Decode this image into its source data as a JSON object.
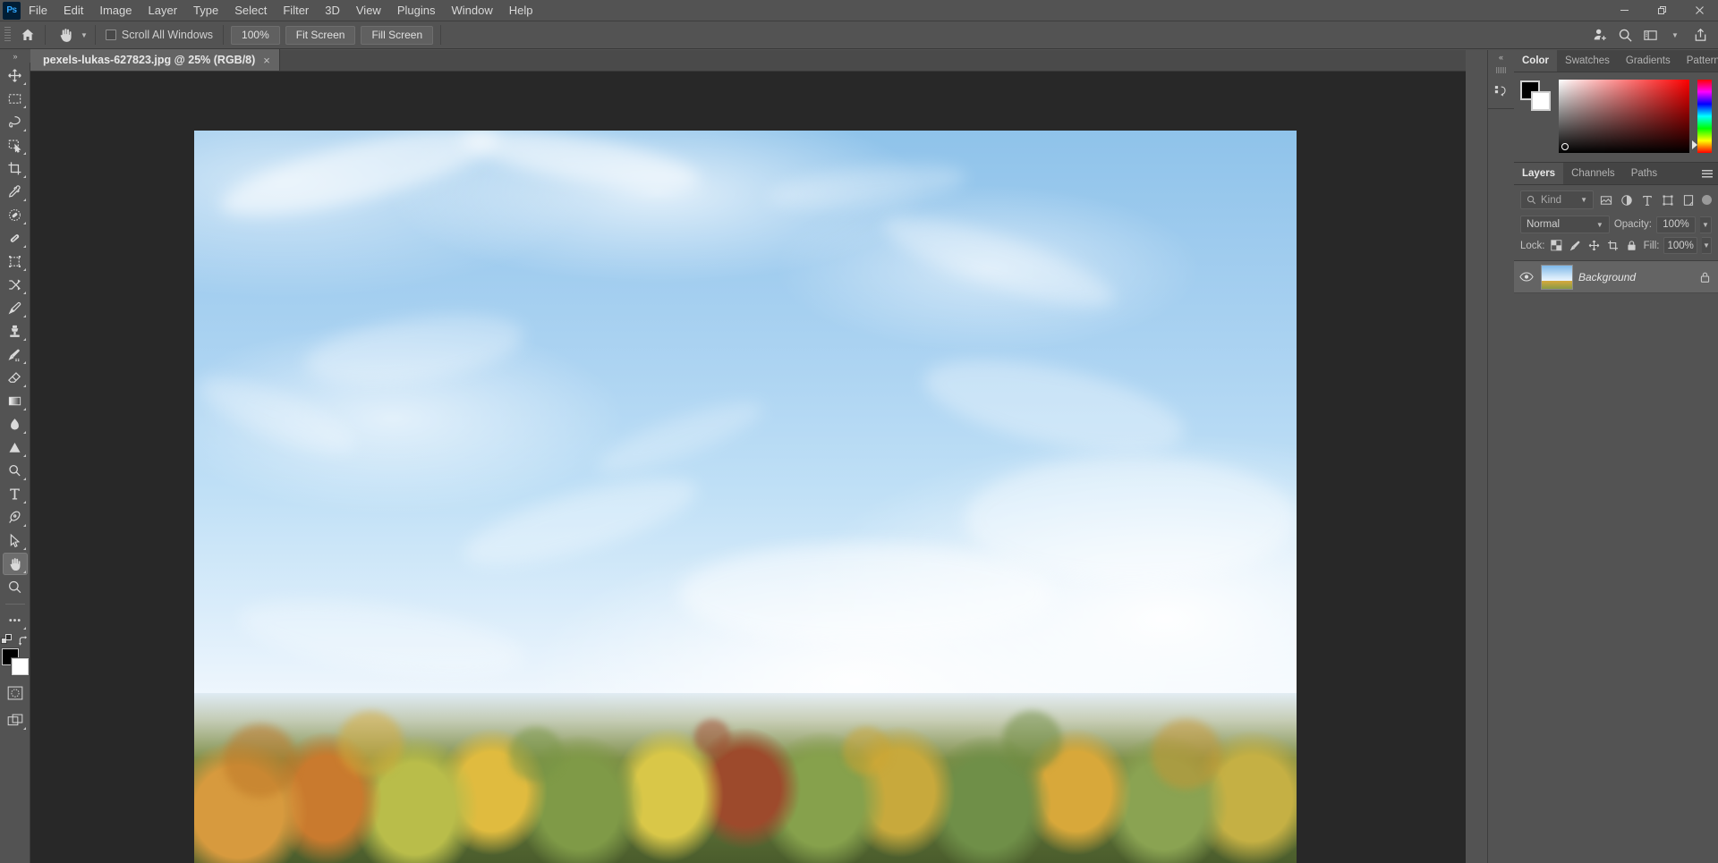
{
  "app": {
    "name": "Adobe Photoshop",
    "logo_text": "Ps"
  },
  "menubar": {
    "items": [
      "File",
      "Edit",
      "Image",
      "Layer",
      "Type",
      "Select",
      "Filter",
      "3D",
      "View",
      "Plugins",
      "Window",
      "Help"
    ],
    "window_controls": [
      "minimize",
      "restore",
      "close"
    ]
  },
  "options_bar": {
    "home_icon": "home-icon",
    "active_tool": "hand-tool",
    "tool_preset_chevron": "chevron-down-icon",
    "scroll_all_windows_label": "Scroll All Windows",
    "scroll_all_windows_checked": false,
    "buttons": [
      "100%",
      "Fit Screen",
      "Fill Screen"
    ],
    "right_icons": [
      "share-user-icon",
      "search-icon",
      "workspace-icon",
      "chevron-down-icon",
      "share-export-icon"
    ]
  },
  "toolbar": {
    "expand_arrows": "»",
    "tools": [
      {
        "name": "move-tool",
        "icon": "move",
        "has_flyout": true,
        "active": false
      },
      {
        "name": "rectangular-marquee-tool",
        "icon": "marquee",
        "has_flyout": true,
        "active": false
      },
      {
        "name": "lasso-tool",
        "icon": "lasso",
        "has_flyout": true,
        "active": false
      },
      {
        "name": "object-selection-tool",
        "icon": "object-select",
        "has_flyout": true,
        "active": false
      },
      {
        "name": "crop-tool",
        "icon": "crop",
        "has_flyout": true,
        "active": false
      },
      {
        "name": "eyedropper-tool",
        "icon": "eyedropper",
        "has_flyout": true,
        "active": false
      },
      {
        "name": "spot-healing-brush-tool",
        "icon": "spot-healing",
        "has_flyout": true,
        "active": false
      },
      {
        "name": "patch-tool",
        "icon": "bandaid",
        "has_flyout": true,
        "active": false
      },
      {
        "name": "frame-tool",
        "icon": "frame",
        "has_flyout": true,
        "active": false
      },
      {
        "name": "shuffle-tool",
        "icon": "shuffle",
        "has_flyout": true,
        "active": false
      },
      {
        "name": "brush-tool",
        "icon": "brush",
        "has_flyout": true,
        "active": false
      },
      {
        "name": "clone-stamp-tool",
        "icon": "stamp",
        "has_flyout": true,
        "active": false
      },
      {
        "name": "history-brush-tool",
        "icon": "history-brush",
        "has_flyout": true,
        "active": false
      },
      {
        "name": "eraser-tool",
        "icon": "eraser",
        "has_flyout": true,
        "active": false
      },
      {
        "name": "gradient-tool",
        "icon": "gradient",
        "has_flyout": true,
        "active": false
      },
      {
        "name": "blur-tool",
        "icon": "droplet",
        "has_flyout": true,
        "active": false
      },
      {
        "name": "dodge-tool",
        "icon": "triangle",
        "has_flyout": true,
        "active": false
      },
      {
        "name": "pen-tool",
        "icon": "magnifier-small",
        "has_flyout": true,
        "active": false
      },
      {
        "name": "type-tool",
        "icon": "type-T",
        "has_flyout": true,
        "active": false
      },
      {
        "name": "path-pen-tool",
        "icon": "pen-nib",
        "has_flyout": true,
        "active": false
      },
      {
        "name": "path-selection-tool",
        "icon": "arrow-pointer",
        "has_flyout": true,
        "active": false
      },
      {
        "name": "hand-tool",
        "icon": "hand",
        "has_flyout": true,
        "active": true
      },
      {
        "name": "zoom-tool",
        "icon": "magnifier",
        "has_flyout": false,
        "active": false
      },
      {
        "name": "edit-toolbar-tool",
        "icon": "ellipsis",
        "has_flyout": true,
        "active": false
      }
    ],
    "default_colors_icon": "default-colors-icon",
    "swap_colors_icon": "swap-colors-icon",
    "foreground_color": "#000000",
    "background_color": "#ffffff",
    "quick_mask_icon": "quick-mask-icon",
    "screen_mode_icon": "screen-mode-icon"
  },
  "document": {
    "tab_title": "pexels-lukas-627823.jpg @ 25% (RGB/8)",
    "close_glyph": "×",
    "zoom_level": "25%",
    "color_mode": "RGB/8",
    "filename": "pexels-lukas-627823.jpg",
    "canvas_background": "#282828",
    "image_description": "Blue sky with wispy cirrus clouds above an autumn forest treeline"
  },
  "collapsed_dock": {
    "collapse_arrows": "«",
    "items": [
      {
        "name": "history-panel-icon",
        "label": "History"
      }
    ]
  },
  "color_panel": {
    "tabs": [
      {
        "label": "Color",
        "active": true
      },
      {
        "label": "Swatches",
        "active": false
      },
      {
        "label": "Gradients",
        "active": false
      },
      {
        "label": "Patterns",
        "active": false
      }
    ],
    "menu_icon": "panel-menu-icon",
    "foreground_color": "#000000",
    "background_color": "#ffffff",
    "picker_hue": "#ff0000"
  },
  "layers_panel": {
    "tabs": [
      {
        "label": "Layers",
        "active": true
      },
      {
        "label": "Channels",
        "active": false
      },
      {
        "label": "Paths",
        "active": false
      }
    ],
    "menu_icon": "panel-menu-icon",
    "filter": {
      "kind_label": "Kind",
      "search_icon": "search-icon",
      "chevron": "chevron-down-icon",
      "filter_icons": [
        "pixel-layers-icon",
        "adjustment-layers-icon",
        "type-layers-icon",
        "shape-layers-icon",
        "smart-object-icon"
      ],
      "toggle_enabled": true
    },
    "blend_mode": "Normal",
    "opacity_label": "Opacity:",
    "opacity_value": "100%",
    "lock_label": "Lock:",
    "lock_icons": [
      "lock-transparent-pixels-icon",
      "lock-image-pixels-icon",
      "lock-position-icon",
      "lock-artboard-icon",
      "lock-all-icon"
    ],
    "fill_label": "Fill:",
    "fill_value": "100%",
    "layers": [
      {
        "name": "Background",
        "visible": true,
        "locked": true,
        "selected": true,
        "eye_icon": "eye-icon",
        "lock_icon": "lock-icon",
        "thumbnail": "sky-and-trees-thumbnail"
      }
    ]
  }
}
